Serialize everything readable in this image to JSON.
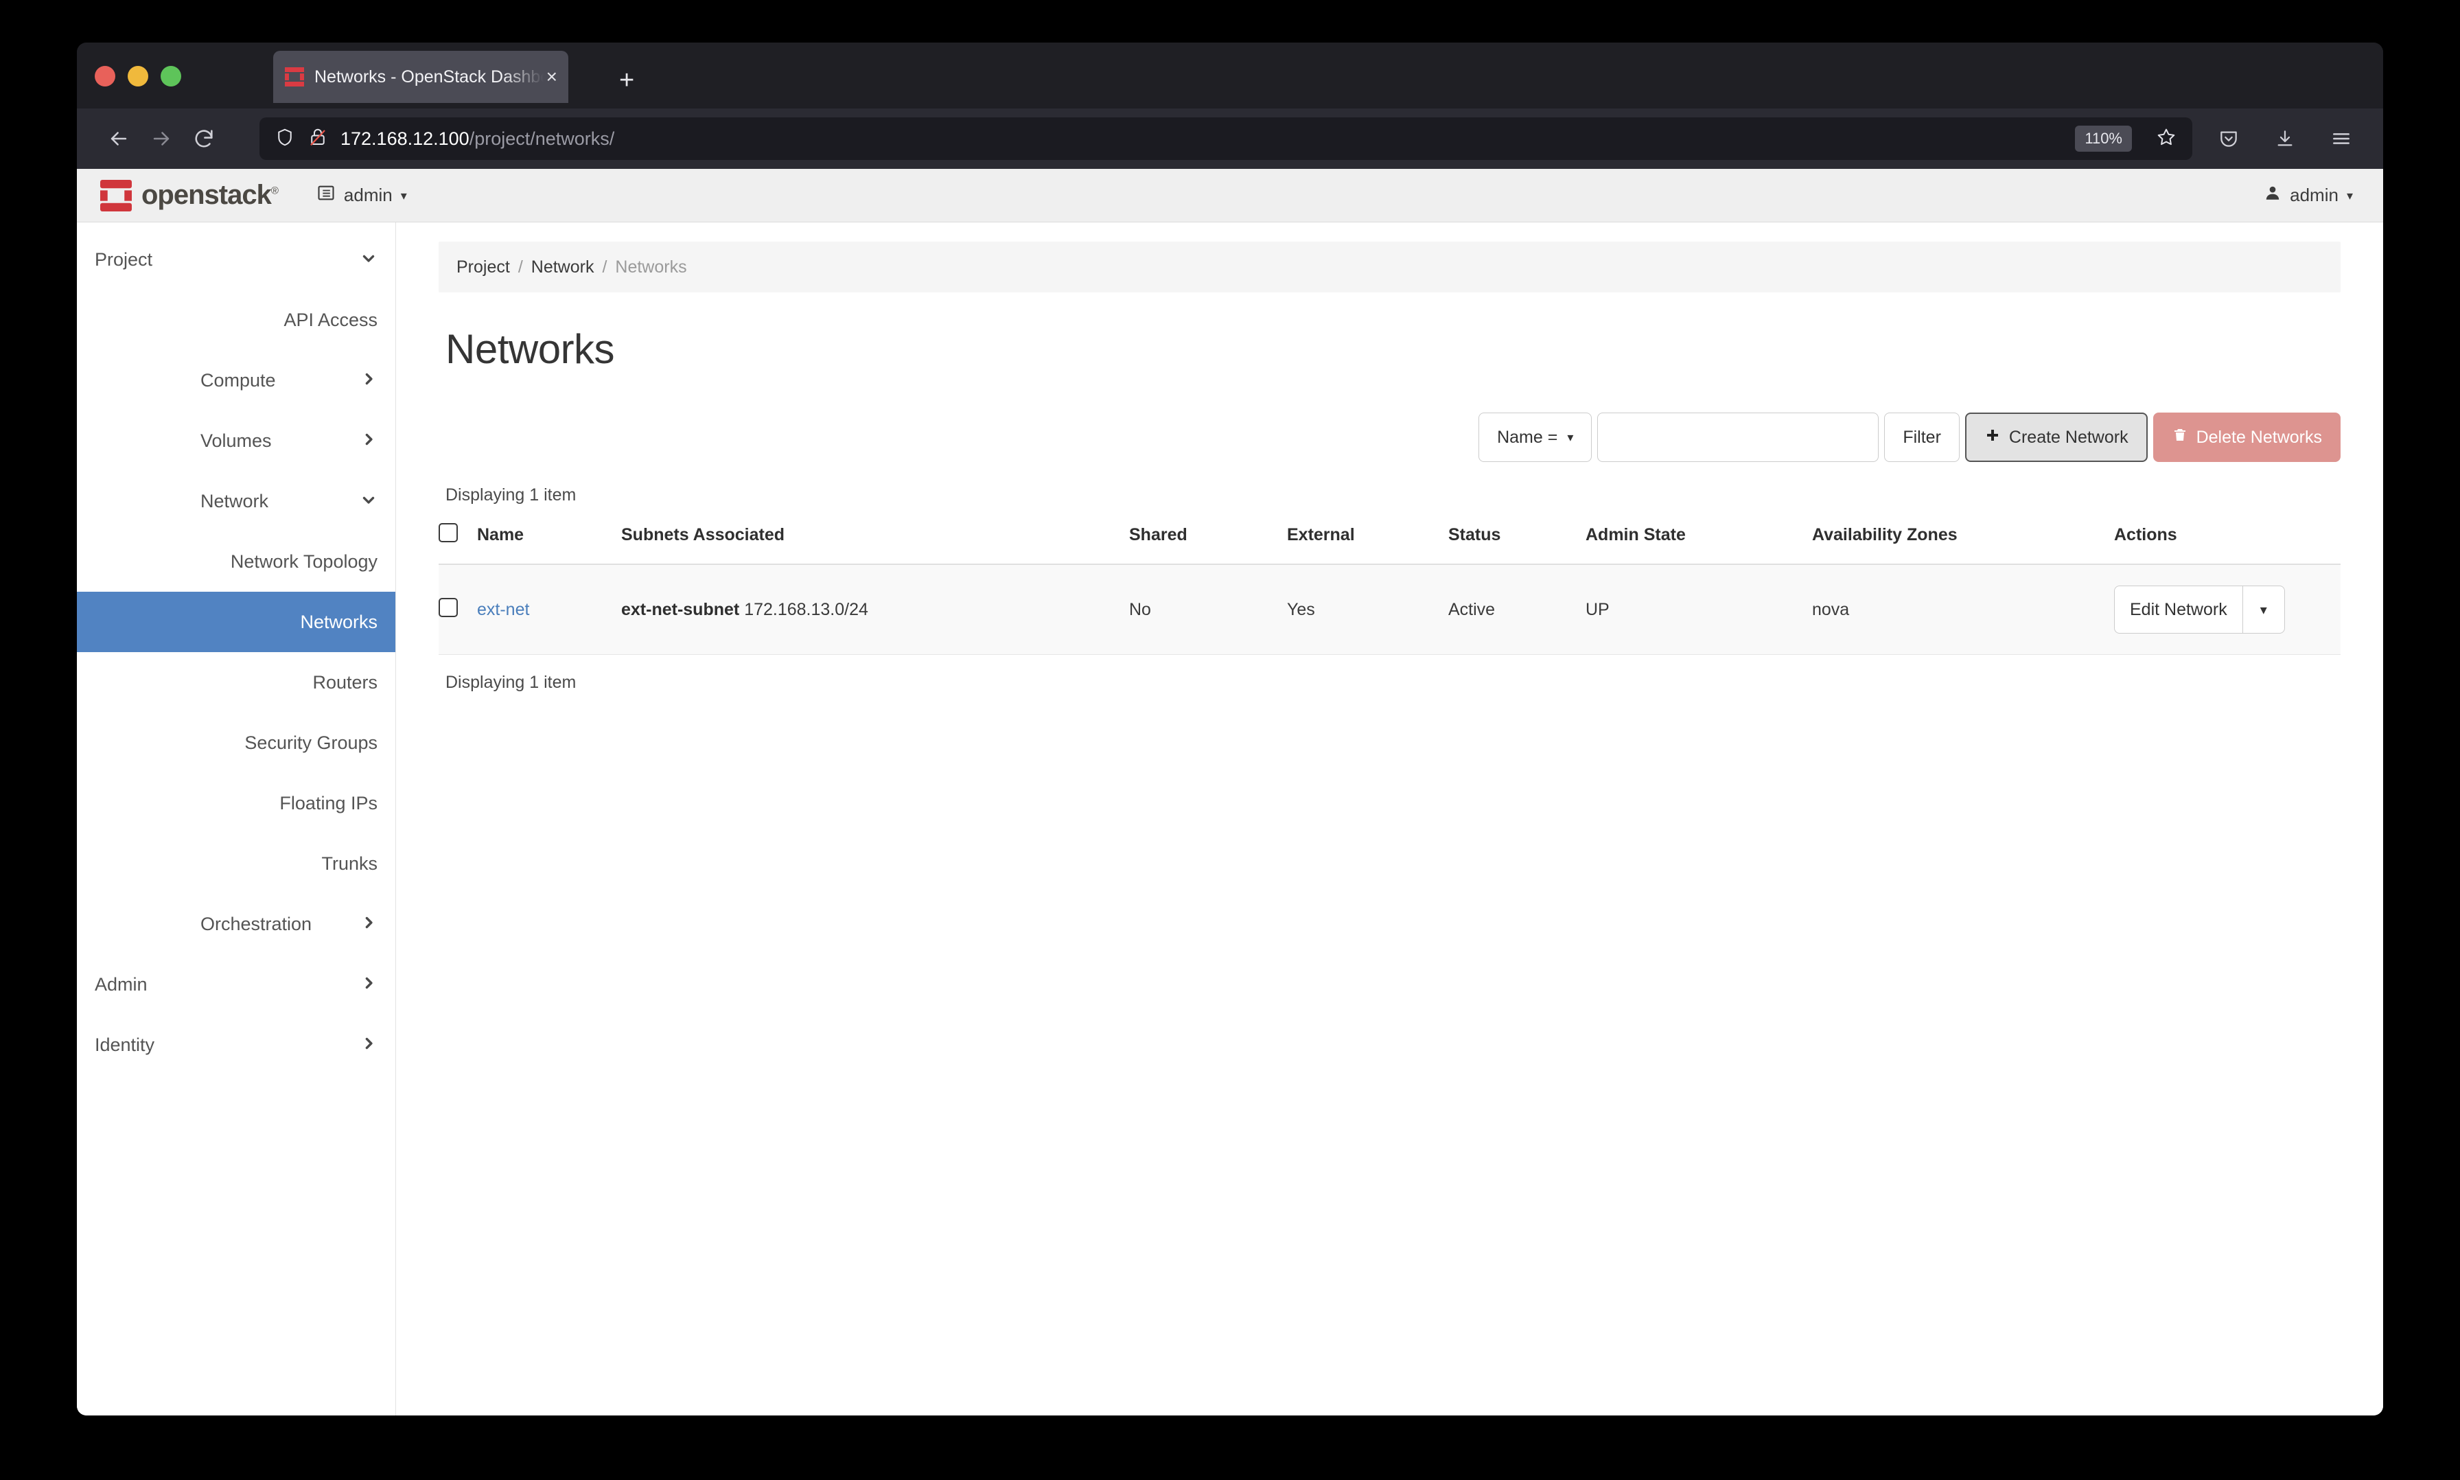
{
  "browser": {
    "tab": {
      "title": "Networks - OpenStack Dashboard",
      "close_label": "×"
    },
    "new_tab_label": "+",
    "url_host": "172.168.12.100",
    "url_path": "/project/networks/",
    "zoom_level": "110%",
    "icons": {
      "back": "back-arrow-icon",
      "forward": "forward-arrow-icon",
      "reload": "reload-icon",
      "shield": "shield-icon",
      "insecure_lock": "crossed-lock-icon",
      "bookmark": "star-icon",
      "pocket": "pocket-save-icon",
      "downloads": "download-icon",
      "menu": "hamburger-menu-icon"
    }
  },
  "header": {
    "brand": "openstack",
    "brand_mark": "registered",
    "project_label": "admin",
    "user_label": "admin",
    "caret": "▾"
  },
  "sidebar": {
    "items": [
      {
        "label": "Project",
        "level": "top",
        "chevron": "down",
        "active": false
      },
      {
        "label": "API Access",
        "level": "leaf",
        "chevron": "",
        "active": false
      },
      {
        "label": "Compute",
        "level": "sub",
        "chevron": "right",
        "active": false
      },
      {
        "label": "Volumes",
        "level": "sub",
        "chevron": "right",
        "active": false
      },
      {
        "label": "Network",
        "level": "sub",
        "chevron": "down",
        "active": false
      },
      {
        "label": "Network Topology",
        "level": "leaf",
        "chevron": "",
        "active": false
      },
      {
        "label": "Networks",
        "level": "leaf",
        "chevron": "",
        "active": true
      },
      {
        "label": "Routers",
        "level": "leaf",
        "chevron": "",
        "active": false
      },
      {
        "label": "Security Groups",
        "level": "leaf",
        "chevron": "",
        "active": false
      },
      {
        "label": "Floating IPs",
        "level": "leaf",
        "chevron": "",
        "active": false
      },
      {
        "label": "Trunks",
        "level": "leaf",
        "chevron": "",
        "active": false
      },
      {
        "label": "Orchestration",
        "level": "sub",
        "chevron": "right",
        "active": false
      },
      {
        "label": "Admin",
        "level": "top",
        "chevron": "right",
        "active": false
      },
      {
        "label": "Identity",
        "level": "top",
        "chevron": "right",
        "active": false
      }
    ],
    "active_color": "#5183c2"
  },
  "breadcrumb": {
    "items": [
      "Project",
      "Network",
      "Networks"
    ],
    "separator": "/"
  },
  "page": {
    "title": "Networks"
  },
  "toolbar": {
    "filter_select": "Name =",
    "filter_select_caret": "▾",
    "search_value": "",
    "search_placeholder": "",
    "filter_button": "Filter",
    "create_button": "Create Network",
    "create_icon": "plus-icon",
    "delete_button": "Delete Networks",
    "delete_icon": "trash-icon",
    "delete_color": "#dd9490"
  },
  "table": {
    "count_top": "Displaying 1 item",
    "count_bottom": "Displaying 1 item",
    "columns": [
      "",
      "Name",
      "Subnets Associated",
      "Shared",
      "External",
      "Status",
      "Admin State",
      "Availability Zones",
      "Actions"
    ],
    "rows": [
      {
        "name": "ext-net",
        "subnet_name": "ext-net-subnet",
        "subnet_cidr": "172.168.13.0/24",
        "shared": "No",
        "external": "Yes",
        "status": "Active",
        "admin_state": "UP",
        "availability_zones": "nova",
        "action_primary": "Edit Network",
        "action_caret": "▾"
      }
    ]
  }
}
